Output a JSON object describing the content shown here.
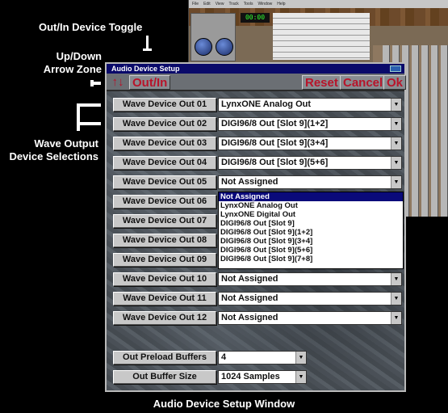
{
  "annotations": {
    "toggle": "Out/In Device Toggle",
    "arrow_zone_line1": "Up/Down",
    "arrow_zone_line2": "Arrow Zone",
    "wave_output_line1": "Wave Output",
    "wave_output_line2": "Device Selections",
    "caption": "Audio Device Setup Window"
  },
  "background_app": {
    "counter": "00:00"
  },
  "dialog": {
    "title": "Audio Device Setup",
    "toolbar": {
      "arrow_zone": "↑↓",
      "toggle": "Out/In",
      "reset": "Reset",
      "cancel": "Cancel",
      "ok": "Ok"
    },
    "rows": [
      {
        "label": "Wave Device Out 01",
        "value": "LynxONE Analog Out"
      },
      {
        "label": "Wave Device Out 02",
        "value": "DIGI96/8 Out [Slot 9](1+2]"
      },
      {
        "label": "Wave Device Out 03",
        "value": "DIGI96/8 Out [Slot 9](3+4]"
      },
      {
        "label": "Wave Device Out 04",
        "value": "DIGI96/8 Out [Slot 9](5+6]"
      },
      {
        "label": "Wave Device Out 05",
        "value": "Not Assigned"
      },
      {
        "label": "Wave Device Out 06",
        "value": ""
      },
      {
        "label": "Wave Device Out 07",
        "value": ""
      },
      {
        "label": "Wave Device Out 08",
        "value": ""
      },
      {
        "label": "Wave Device Out 09",
        "value": ""
      },
      {
        "label": "Wave Device Out 10",
        "value": "Not Assigned"
      },
      {
        "label": "Wave Device Out 11",
        "value": "Not Assigned"
      },
      {
        "label": "Wave Device Out 12",
        "value": "Not Assigned"
      }
    ],
    "dropdown_options": [
      "Not Assigned",
      "LynxONE Analog Out",
      "LynxONE Digital Out",
      "DIGI96/8 Out [Slot 9]",
      "DIGI96/8 Out [Slot 9](1+2]",
      "DIGI96/8 Out [Slot 9](3+4]",
      "DIGI96/8 Out [Slot 9](5+6]",
      "DIGI96/8 Out [Slot 9](7+8]"
    ],
    "preload": {
      "label": "Out Preload Buffers",
      "value": "4"
    },
    "buffer_size": {
      "label": "Out Buffer Size",
      "value": "1024 Samples"
    }
  },
  "colors": {
    "title_bar": "#0a0a6a",
    "toolbar_text": "#b8142a",
    "selection": "#0a0a7a"
  }
}
